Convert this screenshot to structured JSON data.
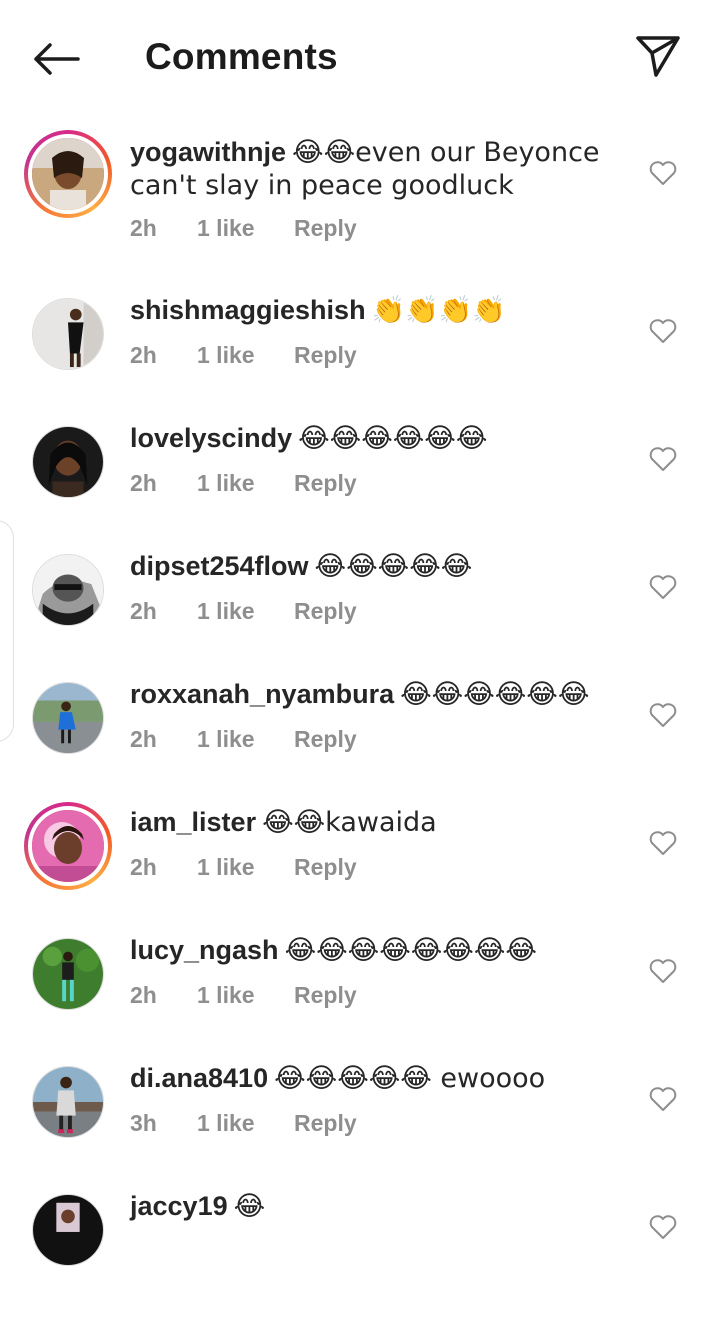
{
  "header": {
    "title": "Comments"
  },
  "colors": {
    "text": "#262626",
    "meta": "#8e8e8e",
    "story_ring": "#e1306c"
  },
  "comments": [
    {
      "username": "yogawithnje",
      "text": "😂😂even our Beyonce can't slay in peace goodluck",
      "time": "2h",
      "likes": "1 like",
      "reply": "Reply",
      "story": true,
      "avatar": "face-sunglasses"
    },
    {
      "username": "shishmaggieshish",
      "text": "👏👏👏👏",
      "time": "2h",
      "likes": "1 like",
      "reply": "Reply",
      "story": false,
      "avatar": "woman-black-dress"
    },
    {
      "username": "lovelyscindy",
      "text": "😂😂😂😂😂😂",
      "time": "2h",
      "likes": "1 like",
      "reply": "Reply",
      "story": false,
      "avatar": "woman-portrait"
    },
    {
      "username": "dipset254flow",
      "text": "😂😂😂😂😂",
      "time": "2h",
      "likes": "1 like",
      "reply": "Reply",
      "story": false,
      "avatar": "bw-portrait"
    },
    {
      "username": "roxxanah_nyambura",
      "text": "😂😂😂😂😂😂",
      "time": "2h",
      "likes": "1 like",
      "reply": "Reply",
      "story": false,
      "avatar": "woman-blue-outdoor"
    },
    {
      "username": "iam_lister",
      "text": "😂😂kawaida",
      "time": "2h",
      "likes": "1 like",
      "reply": "Reply",
      "story": true,
      "avatar": "pink-selfie"
    },
    {
      "username": "lucy_ngash",
      "text": "😂😂😂😂😂😂😂😂",
      "time": "2h",
      "likes": "1 like",
      "reply": "Reply",
      "story": false,
      "avatar": "woman-garden"
    },
    {
      "username": "di.ana8410",
      "text": "😂😂😂😂😂 ewoooo",
      "time": "3h",
      "likes": "1 like",
      "reply": "Reply",
      "story": false,
      "avatar": "woman-fence"
    },
    {
      "username": "jaccy19",
      "text": "😂",
      "time": "",
      "likes": "",
      "reply": "",
      "story": false,
      "avatar": "dark-portrait"
    }
  ]
}
